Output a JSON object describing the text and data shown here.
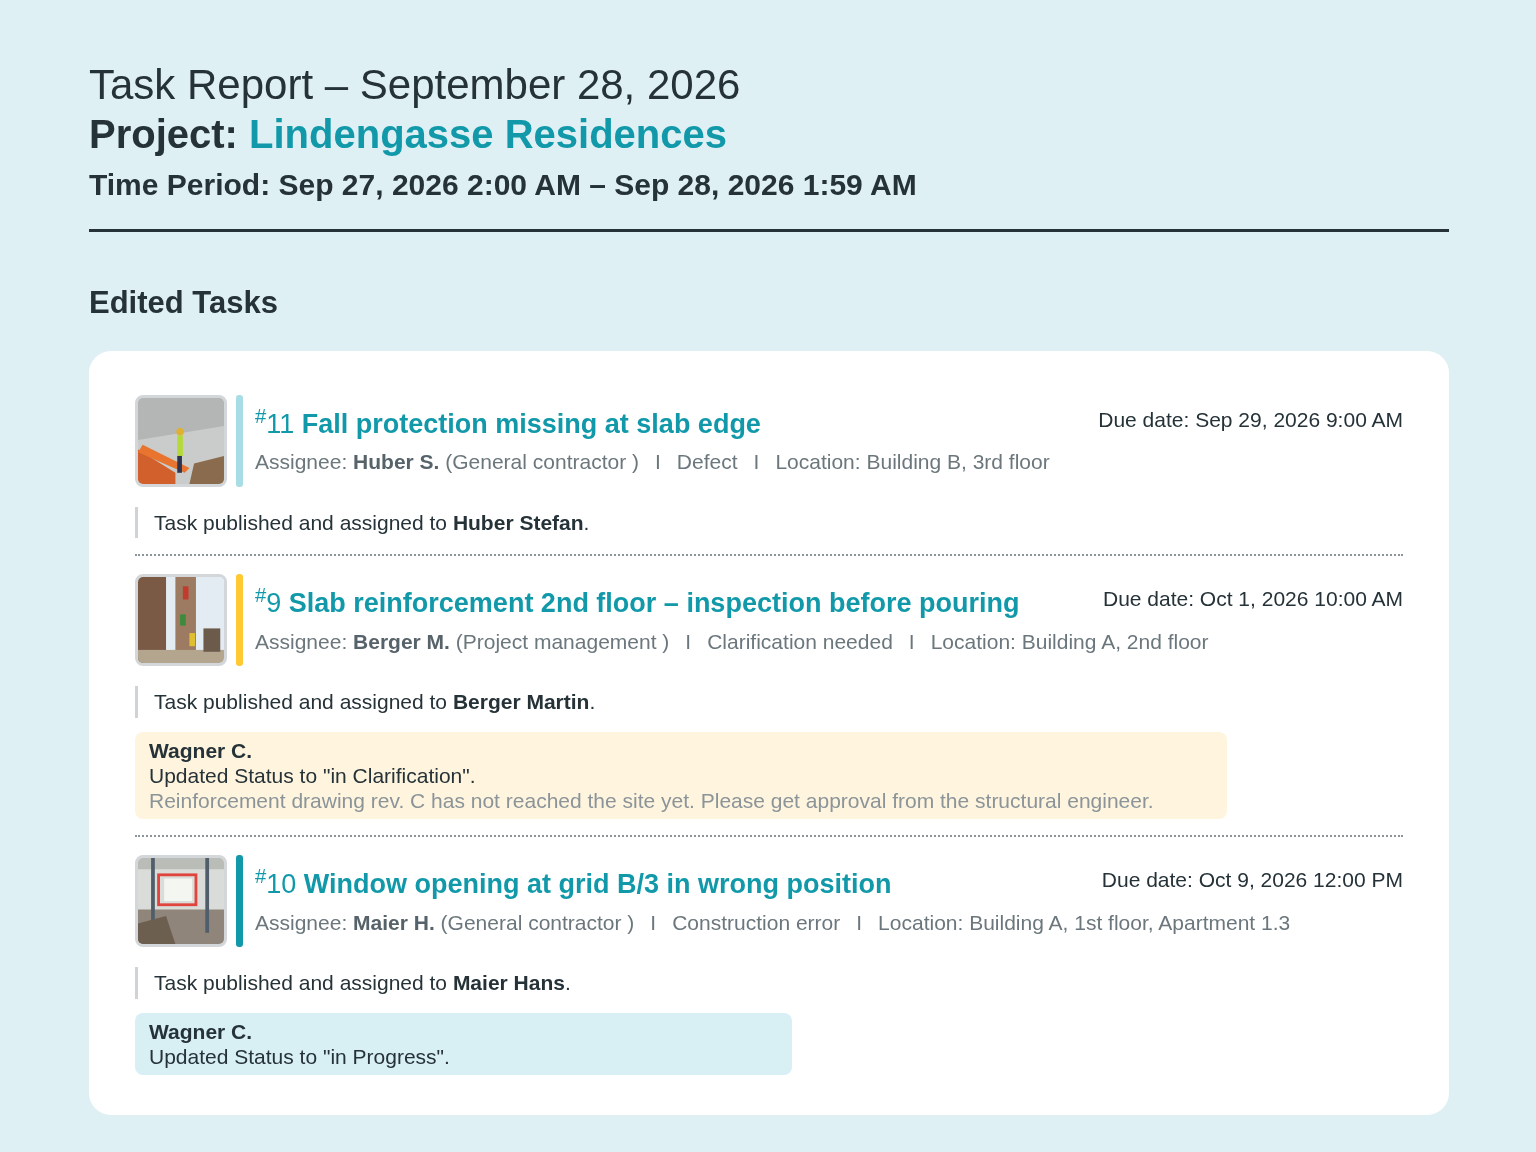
{
  "header": {
    "title": "Task Report – September 28, 2026",
    "project_label": "Project:",
    "project_name": "Lindengasse Residences",
    "period": "Time Period: Sep 27, 2026 2:00 AM – Sep 28, 2026 1:59 AM"
  },
  "section_title": "Edited Tasks",
  "tasks": [
    {
      "number_sign": "#",
      "number": "11",
      "title": "Fall protection missing at slab edge",
      "due": "Due date: Sep 29, 2026 9:00 AM",
      "color": "#a9dde6",
      "kind": "picture",
      "assignee_label": "Assignee:",
      "assignee": "Huber S.",
      "company": "(General contractor )",
      "separator_1": "I",
      "type": "Defect",
      "separator_2": "I",
      "location": "Location: Building B, 3rd floor",
      "log": "Task published and assigned to **Huber Stefan**."
    },
    {
      "number_sign": "#",
      "number": "9",
      "title": "Slab reinforcement 2nd floor – inspection before pouring",
      "due": "Due date: Oct 1, 2026 10:00 AM",
      "color": "#ffc933",
      "kind": "picture",
      "assignee_label": "Assignee:",
      "assignee": "Berger M.",
      "company": "(Project management )",
      "separator_1": "I",
      "type": "Clarification needed",
      "separator_2": "I",
      "location": "Location: Building A, 2nd floor",
      "log": "Task published and assigned to **Berger Martin**.",
      "comments": [
        {
          "author": "Wagner C.",
          "color": "#fff4de",
          "lines": [
            "Updated Status to \"in Clarification\"."
          ],
          "note": "Reinforcement drawing rev. C has not reached the site yet. Please get approval from the structural engineer."
        }
      ]
    },
    {
      "number_sign": "#",
      "number": "10",
      "title": "Window opening at grid B/3 in wrong position",
      "due": "Due date: Oct 9, 2026 12:00 PM",
      "color": "#1199aa",
      "kind": "picture",
      "assignee_label": "Assignee:",
      "assignee": "Maier H.",
      "company": "(General contractor )",
      "separator_1": "I",
      "type": "Construction error",
      "separator_2": "I",
      "location": "Location: Building A, 1st floor, Apartment 1.3",
      "log": "Task published and assigned to **Maier Hans**.",
      "comments": [
        {
          "author": "Wagner C.",
          "color": "#d8eff4",
          "lines": [
            "Updated Status to \"in Progress\"."
          ]
        }
      ]
    }
  ]
}
